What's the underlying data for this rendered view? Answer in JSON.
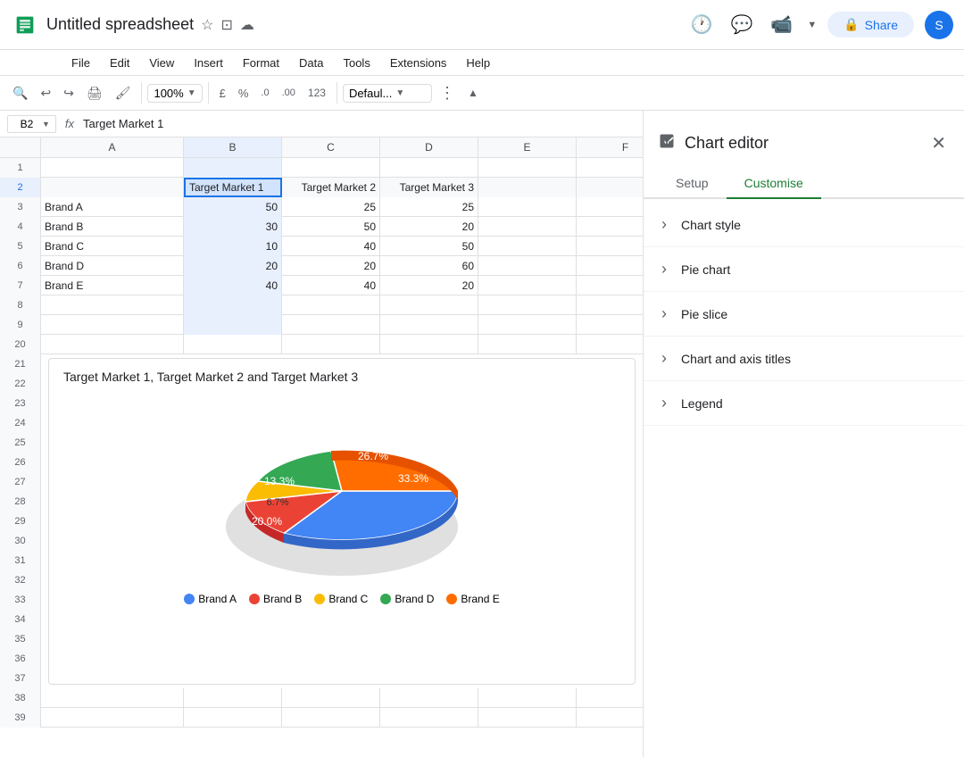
{
  "app": {
    "icon_color": "#34a853",
    "title": "Untitled spreadsheet",
    "avatar_letter": "S"
  },
  "title_icons": [
    "star",
    "folder",
    "cloud"
  ],
  "menu": {
    "items": [
      "File",
      "Edit",
      "View",
      "Insert",
      "Format",
      "Data",
      "Tools",
      "Extensions",
      "Help"
    ]
  },
  "toolbar": {
    "zoom": "100%",
    "currency_symbol": "£",
    "percent_symbol": "%",
    "decimal_decrease": ".0",
    "decimal_increase": ".00",
    "format_number": "123",
    "font_selector": "Defaul...",
    "more_icon": "⋮",
    "collapse_icon": "▲"
  },
  "formula_bar": {
    "cell_ref": "B2",
    "formula_symbol": "fx",
    "value": "Target Market 1"
  },
  "columns": [
    "A",
    "B",
    "C",
    "D",
    "E",
    "F"
  ],
  "rows": [
    {
      "num": 1,
      "cells": [
        "",
        "",
        "",
        "",
        "",
        ""
      ]
    },
    {
      "num": 2,
      "cells": [
        "",
        "Target Market 1",
        "Target Market 2",
        "Target Market 3",
        "",
        ""
      ],
      "highlight": true
    },
    {
      "num": 3,
      "cells": [
        "Brand A",
        "50",
        "25",
        "25",
        "",
        ""
      ]
    },
    {
      "num": 4,
      "cells": [
        "Brand B",
        "30",
        "50",
        "20",
        "",
        ""
      ]
    },
    {
      "num": 5,
      "cells": [
        "Brand C",
        "10",
        "40",
        "50",
        "",
        ""
      ]
    },
    {
      "num": 6,
      "cells": [
        "Brand D",
        "20",
        "20",
        "60",
        "",
        ""
      ]
    },
    {
      "num": 7,
      "cells": [
        "Brand E",
        "40",
        "40",
        "20",
        "",
        ""
      ]
    },
    {
      "num": 8,
      "cells": [
        "",
        "",
        "",
        "",
        "",
        ""
      ]
    },
    {
      "num": 9,
      "cells": [
        "",
        "",
        "",
        "",
        "",
        ""
      ]
    }
  ],
  "gap_rows": [
    20
  ],
  "chart": {
    "title": "Target Market 1, Target Market 2 and Target Market 3",
    "slices": [
      {
        "label": "Brand A",
        "value": 33.3,
        "color": "#4285f4",
        "start_angle": 0,
        "sweep": 120
      },
      {
        "label": "Brand B",
        "value": 20.0,
        "color": "#ea4335",
        "start_angle": 120,
        "sweep": 72
      },
      {
        "label": "Brand C",
        "value": 6.7,
        "color": "#fbbc04",
        "start_angle": 192,
        "sweep": 24
      },
      {
        "label": "Brand D",
        "value": 13.3,
        "color": "#34a853",
        "start_angle": 216,
        "sweep": 48
      },
      {
        "label": "Brand E",
        "value": 26.7,
        "color": "#ff6d00",
        "start_angle": 264,
        "sweep": 96
      }
    ],
    "legend": [
      {
        "label": "Brand A",
        "color": "#4285f4"
      },
      {
        "label": "Brand B",
        "color": "#ea4335"
      },
      {
        "label": "Brand C",
        "color": "#fbbc04"
      },
      {
        "label": "Brand D",
        "color": "#34a853"
      },
      {
        "label": "Brand E",
        "color": "#ff6d00"
      }
    ]
  },
  "chart_editor": {
    "title": "Chart editor",
    "tabs": [
      "Setup",
      "Customise"
    ],
    "active_tab": "Customise",
    "sections": [
      {
        "label": "Chart style"
      },
      {
        "label": "Pie chart"
      },
      {
        "label": "Pie slice"
      },
      {
        "label": "Chart and axis titles"
      },
      {
        "label": "Legend"
      }
    ]
  }
}
